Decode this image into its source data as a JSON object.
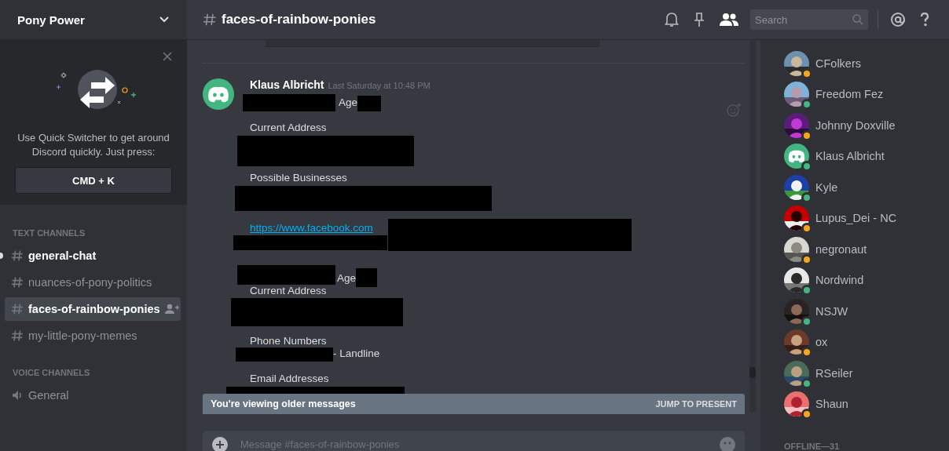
{
  "server": {
    "name": "Pony Power"
  },
  "quick_switcher": {
    "text": "Use Quick Switcher to get around Discord quickly. Just press:",
    "shortcut": "CMD + K"
  },
  "channel_groups": [
    {
      "title": "TEXT CHANNELS",
      "channels": [
        {
          "name": "general-chat",
          "kind": "text",
          "selected": false,
          "unread": true
        },
        {
          "name": "nuances-of-pony-politics",
          "kind": "text",
          "selected": false,
          "unread": false
        },
        {
          "name": "faces-of-rainbow-ponies",
          "kind": "text",
          "selected": true,
          "unread": false
        },
        {
          "name": "my-little-pony-memes",
          "kind": "text",
          "selected": false,
          "unread": false
        }
      ]
    },
    {
      "title": "VOICE CHANNELS",
      "channels": [
        {
          "name": "General",
          "kind": "voice",
          "selected": false,
          "unread": false
        }
      ]
    }
  ],
  "channel_header": {
    "name": "faces-of-rainbow-ponies"
  },
  "toolbar": {
    "search": {
      "placeholder": "Search"
    },
    "members_active": true
  },
  "message": {
    "author": "Klaus Albricht",
    "timestamp": "Last Saturday at 10:48 PM",
    "lines": [
      {
        "kind": "redaction"
      },
      {
        "kind": "text",
        "text": "Age"
      },
      {
        "kind": "redaction"
      },
      {
        "kind": "text",
        "text": "Current Address"
      },
      {
        "kind": "redaction"
      },
      {
        "kind": "text",
        "text": "Possible Businesses"
      },
      {
        "kind": "redaction"
      },
      {
        "kind": "link",
        "text": "https://www.facebook.com"
      },
      {
        "kind": "redaction"
      },
      {
        "kind": "redaction"
      },
      {
        "kind": "redaction"
      },
      {
        "kind": "text",
        "text": "Age"
      },
      {
        "kind": "redaction"
      },
      {
        "kind": "text",
        "text": "Current Address"
      },
      {
        "kind": "redaction"
      },
      {
        "kind": "text",
        "text": "Phone Numbers"
      },
      {
        "kind": "redaction"
      },
      {
        "kind": "text",
        "text": "- Landline"
      },
      {
        "kind": "text",
        "text": "Email Addresses"
      },
      {
        "kind": "redaction"
      }
    ]
  },
  "older_banner": {
    "text": "You're viewing older messages",
    "action": "JUMP TO PRESENT"
  },
  "composer": {
    "placeholder": "Message #faces-of-rainbow-ponies"
  },
  "members": [
    {
      "name": "CFolkers",
      "color": "#faa61a"
    },
    {
      "name": "Freedom Fez",
      "color": "#43b581"
    },
    {
      "name": "Johnny Doxville",
      "color": "#faa61a"
    },
    {
      "name": "Klaus Albricht",
      "kind": "discord",
      "color": "#43b581"
    },
    {
      "name": "Kyle",
      "color": "#43b581"
    },
    {
      "name": "Lupus_Dei - NC",
      "color": "#faa61a"
    },
    {
      "name": "negronaut",
      "color": "#faa61a"
    },
    {
      "name": "Nordwind",
      "color": "#43b581"
    },
    {
      "name": "NSJW",
      "color": "#43b581"
    },
    {
      "name": "ox",
      "color": "#faa61a"
    },
    {
      "name": "RSeiler",
      "color": "#43b581"
    },
    {
      "name": "Shaun",
      "color": "#faa61a"
    }
  ],
  "offline_header": "OFFLINE—31"
}
